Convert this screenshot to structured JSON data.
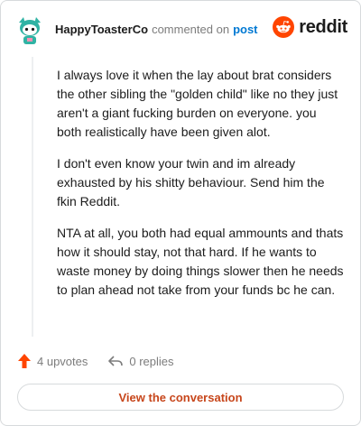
{
  "header": {
    "username": "HappyToasterCo",
    "commented_text": "commented on",
    "post_link": "post",
    "brand": "reddit",
    "avatar_icon": "snoo-avatar-icon",
    "logo_icon": "reddit-logo-icon"
  },
  "comment": {
    "paragraphs": [
      "I always love it when the lay about brat considers the other sibling the \"golden child\" like no they just aren't a giant fucking burden on everyone. you both realistically have been given alot.",
      "I don't even know your twin and im already exhausted by his shitty behaviour. Send him the fkin Reddit.",
      "NTA at all, you both had equal ammounts and thats how it should stay, not that hard. If he wants to waste money by doing things slower then he needs to plan ahead not take from your funds bc he can."
    ]
  },
  "actions": {
    "upvotes": "4 upvotes",
    "replies": "0 replies"
  },
  "cta": {
    "label": "View the conversation"
  },
  "colors": {
    "accent": "#ff4500",
    "link": "#0079d3",
    "cta": "#c7461b",
    "avatar_teal": "#30b3a4"
  }
}
